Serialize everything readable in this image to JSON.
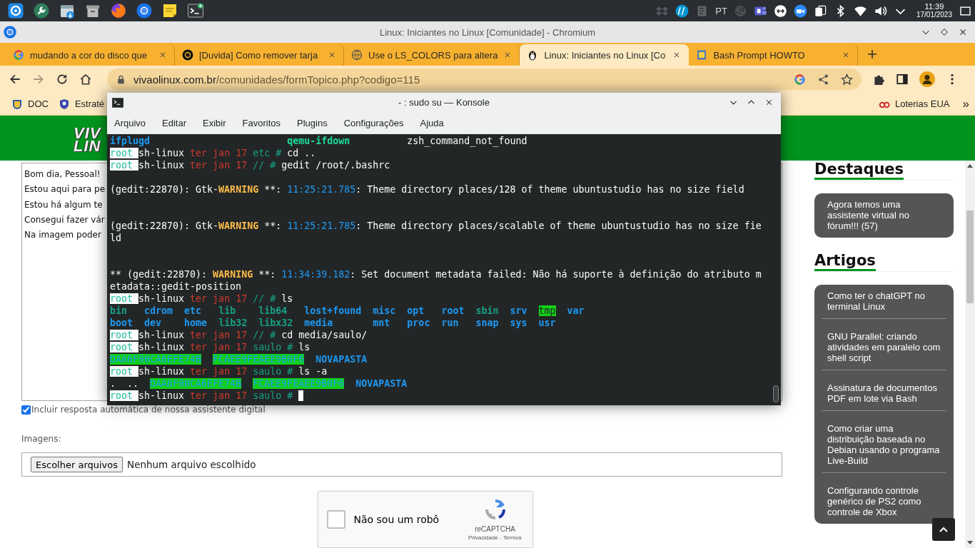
{
  "taskbar": {
    "language": "PT",
    "time": "11:39",
    "date": "17/01/2023"
  },
  "browser": {
    "window_title": "Linux: Iniciantes no Linux [Comunidade] - Chromium",
    "tabs": [
      {
        "kind": "google",
        "title": "mudando a cor do disco que",
        "selected": false
      },
      {
        "kind": "disc",
        "title": "[Duvida] Como remover tarja",
        "selected": false
      },
      {
        "kind": "globe",
        "title": "Use o LS_COLORS para altera",
        "selected": false
      },
      {
        "kind": "penguin",
        "title": "Linux: Iniciantes no Linux [Co",
        "selected": true
      },
      {
        "kind": "document",
        "title": "Bash Prompt HOWTO",
        "selected": false
      }
    ],
    "forward_enabled": false,
    "url_host": "vivaolinux.com.br",
    "url_path": "/comunidades/formTopico.php?codigo=115",
    "bookmarks_left": [
      {
        "kind": "crest",
        "label": "DOC"
      },
      {
        "kind": "shield",
        "label": "Estraté"
      }
    ],
    "bookmarks_right": [
      {
        "kind": "rings",
        "label": "Loterias EUA"
      }
    ],
    "more": "»"
  },
  "page": {
    "logo_lines": [
      "VIV",
      "LIN"
    ],
    "message_lines": [
      "Bom dia, Pessoal!",
      "Estou aqui para pe",
      "Estou há algum te",
      "Consegui fazer vár",
      "Na imagem poder"
    ],
    "auto_reply": {
      "label": "Incluir resposta automática de nossa assistente digital",
      "checked": true
    },
    "images_label": "Imagens:",
    "file_button": "Escolher arquivos",
    "file_status": "Nenhum arquivo escolhido",
    "captcha": {
      "label": "Não sou um robô",
      "checked": false,
      "brand": "reCAPTCHA",
      "links": "Privacidade - Termos"
    },
    "sidebar": [
      {
        "title": "Destaques",
        "items": [
          "Agora temos uma assistente virtual no fórum!!! (57)"
        ]
      },
      {
        "title": "Artigos",
        "items": [
          "Como ter o chatGPT no terminal Linux",
          "GNU Parallel: criando atividades em paralelo com shell script",
          "Assinatura de documentos PDF em lote via Bash",
          "Como criar uma distribuição baseada no Debian usando o programa Live-Build",
          "Configurando controle genérico de PS2 como controle de Xbox"
        ]
      }
    ]
  },
  "konsole": {
    "title": "- : sudo su — Konsole",
    "menu": [
      "Arquivo",
      "Editar",
      "Exibir",
      "Favoritos",
      "Plugins",
      "Configurações",
      "Ajuda"
    ],
    "lines": [
      {
        "kind": "text",
        "segments": [
          {
            "kind": "directory",
            "t": "ifplugd                        "
          },
          {
            "kind": "executable",
            "t": "qemu-ifdown          "
          },
          {
            "kind": "plain",
            "t": "zsh_command_not_found"
          }
        ]
      },
      {
        "kind": "text",
        "segments": [
          {
            "kind": "user",
            "t": "root "
          },
          {
            "kind": "host",
            "t": "sh-linux "
          },
          {
            "kind": "date",
            "t": "ter jan 17 "
          },
          {
            "kind": "path",
            "t": "etc # "
          },
          {
            "kind": "plain",
            "t": "cd .."
          }
        ]
      },
      {
        "kind": "text",
        "segments": [
          {
            "kind": "user",
            "t": "root "
          },
          {
            "kind": "host",
            "t": "sh-linux "
          },
          {
            "kind": "date",
            "t": "ter jan 17 "
          },
          {
            "kind": "path",
            "t": "// # "
          },
          {
            "kind": "plain",
            "t": "gedit /root/.bashrc"
          }
        ]
      },
      {
        "kind": "blank"
      },
      {
        "kind": "text",
        "segments": [
          {
            "kind": "plain",
            "t": "(gedit:22870): Gtk-"
          },
          {
            "kind": "warning",
            "t": "WARNING"
          },
          {
            "kind": "plain",
            "t": " **: "
          },
          {
            "kind": "timestamp",
            "t": "11:25:21.785"
          },
          {
            "kind": "plain",
            "t": ": Theme directory places/128 of theme ubuntustudio has no size field"
          }
        ]
      },
      {
        "kind": "blank"
      },
      {
        "kind": "blank"
      },
      {
        "kind": "text",
        "segments": [
          {
            "kind": "plain",
            "t": "(gedit:22870): Gtk-"
          },
          {
            "kind": "warning",
            "t": "WARNING"
          },
          {
            "kind": "plain",
            "t": " **: "
          },
          {
            "kind": "timestamp",
            "t": "11:25:21.785"
          },
          {
            "kind": "plain",
            "t": ": Theme directory places/scalable of theme ubuntustudio has no size fie"
          }
        ]
      },
      {
        "kind": "text",
        "segments": [
          {
            "kind": "plain",
            "t": "ld"
          }
        ]
      },
      {
        "kind": "blank"
      },
      {
        "kind": "blank"
      },
      {
        "kind": "text",
        "segments": [
          {
            "kind": "plain",
            "t": "** (gedit:22870): "
          },
          {
            "kind": "warning",
            "t": "WARNING"
          },
          {
            "kind": "plain",
            "t": " **: "
          },
          {
            "kind": "timestamp",
            "t": "11:34:39.182"
          },
          {
            "kind": "plain",
            "t": ": Set document metadata failed: Não há suporte à definição do atributo m"
          }
        ]
      },
      {
        "kind": "text",
        "segments": [
          {
            "kind": "plain",
            "t": "etadata::gedit-position"
          }
        ]
      },
      {
        "kind": "text",
        "segments": [
          {
            "kind": "user",
            "t": "root "
          },
          {
            "kind": "host",
            "t": "sh-linux "
          },
          {
            "kind": "date",
            "t": "ter jan 17 "
          },
          {
            "kind": "path",
            "t": "// # "
          },
          {
            "kind": "plain",
            "t": "ls"
          }
        ]
      },
      {
        "kind": "text",
        "segments": [
          {
            "kind": "link",
            "t": "bin   "
          },
          {
            "kind": "directory",
            "t": "cdrom  "
          },
          {
            "kind": "directory",
            "t": "etc   "
          },
          {
            "kind": "link",
            "t": "lib    "
          },
          {
            "kind": "link",
            "t": "lib64   "
          },
          {
            "kind": "directory",
            "t": "lost+found  "
          },
          {
            "kind": "directory",
            "t": "misc  "
          },
          {
            "kind": "directory",
            "t": "opt   "
          },
          {
            "kind": "directory",
            "t": "root  "
          },
          {
            "kind": "link",
            "t": "sbin  "
          },
          {
            "kind": "directory",
            "t": "srv  "
          },
          {
            "kind": "sticky",
            "t": "tmp"
          },
          {
            "kind": "directory",
            "t": "  var"
          }
        ]
      },
      {
        "kind": "text",
        "segments": [
          {
            "kind": "directory",
            "t": "boot  "
          },
          {
            "kind": "directory",
            "t": "dev    "
          },
          {
            "kind": "directory",
            "t": "home  "
          },
          {
            "kind": "link",
            "t": "lib32  "
          },
          {
            "kind": "link",
            "t": "libx32  "
          },
          {
            "kind": "directory",
            "t": "media       "
          },
          {
            "kind": "directory",
            "t": "mnt   "
          },
          {
            "kind": "directory",
            "t": "proc  "
          },
          {
            "kind": "directory",
            "t": "run   "
          },
          {
            "kind": "directory",
            "t": "snap  "
          },
          {
            "kind": "directory",
            "t": "sys  "
          },
          {
            "kind": "directory",
            "t": "usr"
          }
        ]
      },
      {
        "kind": "text",
        "segments": [
          {
            "kind": "user",
            "t": "root "
          },
          {
            "kind": "host",
            "t": "sh-linux "
          },
          {
            "kind": "date",
            "t": "ter jan 17 "
          },
          {
            "kind": "path",
            "t": "// # "
          },
          {
            "kind": "plain",
            "t": "cd media/saulo/"
          }
        ]
      },
      {
        "kind": "text",
        "segments": [
          {
            "kind": "user",
            "t": "root "
          },
          {
            "kind": "host",
            "t": "sh-linux "
          },
          {
            "kind": "date",
            "t": "ter jan 17 "
          },
          {
            "kind": "path",
            "t": "saulo # "
          },
          {
            "kind": "plain",
            "t": "ls"
          }
        ]
      },
      {
        "kind": "text",
        "segments": [
          {
            "kind": "highlight",
            "t": "DAA6F00CA6EFE74B  "
          },
          {
            "kind": "highlight",
            "t": "FCAEE9FEAEE9B0F6"
          },
          {
            "kind": "directory",
            "t": "  NOVAPASTA"
          }
        ]
      },
      {
        "kind": "text",
        "segments": [
          {
            "kind": "user",
            "t": "root "
          },
          {
            "kind": "host",
            "t": "sh-linux "
          },
          {
            "kind": "date",
            "t": "ter jan 17 "
          },
          {
            "kind": "path",
            "t": "saulo # "
          },
          {
            "kind": "plain",
            "t": "ls -a"
          }
        ]
      },
      {
        "kind": "text",
        "segments": [
          {
            "kind": "plain",
            "t": ".  ..  "
          },
          {
            "kind": "highlight",
            "t": "DAA6F00CA6EFE74B  "
          },
          {
            "kind": "highlight",
            "t": "FCAEE9FEAEE9B0F6"
          },
          {
            "kind": "directory",
            "t": "  NOVAPASTA"
          }
        ]
      },
      {
        "kind": "text",
        "cursor": true,
        "segments": [
          {
            "kind": "user",
            "t": "root "
          },
          {
            "kind": "host",
            "t": "sh-linux "
          },
          {
            "kind": "date",
            "t": "ter jan 17 "
          },
          {
            "kind": "path",
            "t": "saulo # "
          }
        ]
      }
    ]
  }
}
